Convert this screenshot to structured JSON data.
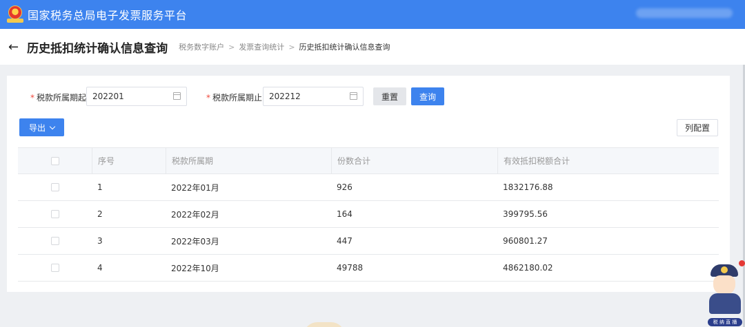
{
  "topbar": {
    "title": "国家税务总局电子发票服务平台",
    "emblem": "tax-emblem"
  },
  "header": {
    "back_icon": "←",
    "title": "历史抵扣统计确认信息查询",
    "breadcrumb": [
      "税务数字账户",
      "发票查询统计",
      "历史抵扣统计确认信息查询"
    ],
    "separator": ">"
  },
  "filters": {
    "start_label": "税款所属期起",
    "start_value": "202201",
    "end_label": "税款所属期止",
    "end_value": "202212",
    "required_mark": "*",
    "reset_label": "重置",
    "query_label": "查询"
  },
  "toolbar": {
    "export_label": "导出",
    "columns_label": "列配置"
  },
  "table": {
    "headers": [
      "序号",
      "税款所属期",
      "份数合计",
      "有效抵扣税额合计"
    ],
    "rows": [
      {
        "no": "1",
        "period": "2022年01月",
        "count": "926",
        "tax": "1832176.88"
      },
      {
        "no": "2",
        "period": "2022年02月",
        "count": "164",
        "tax": "399795.56"
      },
      {
        "no": "3",
        "period": "2022年03月",
        "count": "447",
        "tax": "960801.27"
      },
      {
        "no": "4",
        "period": "2022年10月",
        "count": "49788",
        "tax": "4862180.02"
      }
    ]
  },
  "mascot": {
    "label": "税 纳 直 播"
  },
  "colors": {
    "primary": "#3d83ee",
    "required": "#f04a3e",
    "background": "#eef0f3"
  }
}
